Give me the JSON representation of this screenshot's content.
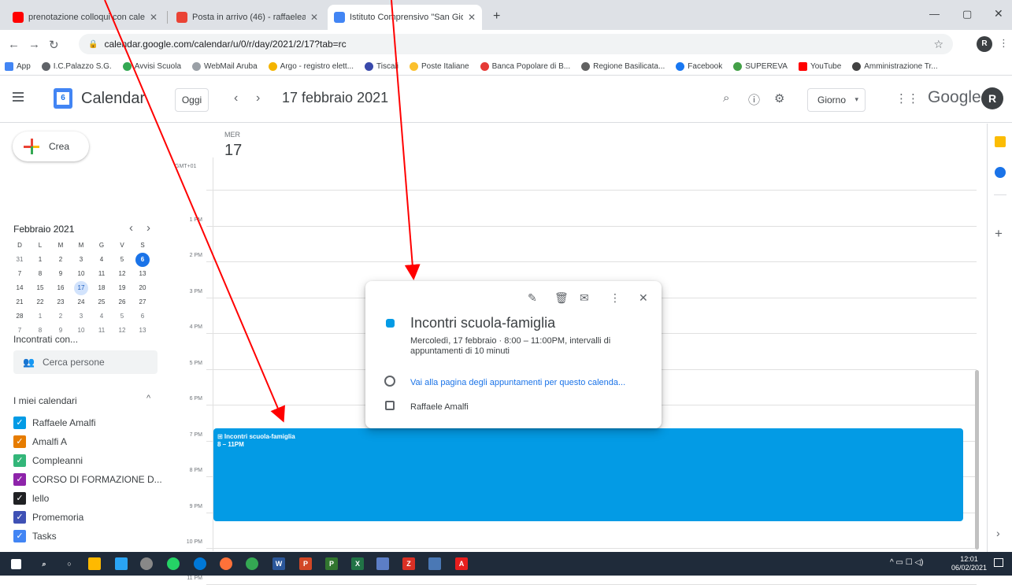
{
  "browser": {
    "tabs": [
      {
        "label": "prenotazione colloqui con calend",
        "color": "#ff0000"
      },
      {
        "label": "Posta in arrivo (46) - raffaeleamal",
        "color": "#ea4335"
      },
      {
        "label": "Istituto Comprensivo \"San Giova",
        "color": "#4285f4"
      }
    ],
    "new_tab": "+",
    "url": "calendar.google.com/calendar/u/0/r/day/2021/2/17?tab=rc",
    "bookmarks": [
      {
        "label": "App",
        "color": "#4285f4"
      },
      {
        "label": "I.C.Palazzo S.G.",
        "color": "#5f6368"
      },
      {
        "label": "Avvisi Scuola",
        "color": "#34a853"
      },
      {
        "label": "WebMail Aruba",
        "color": "#9aa0a6"
      },
      {
        "label": "Argo - registro elett...",
        "color": "#f4b400"
      },
      {
        "label": "Tiscali",
        "color": "#3949ab"
      },
      {
        "label": "Poste Italiane",
        "color": "#fbc02d"
      },
      {
        "label": "Banca Popolare di B...",
        "color": "#e53935"
      },
      {
        "label": "Regione Basilicata...",
        "color": "#616161"
      },
      {
        "label": "Facebook",
        "color": "#1877f2"
      },
      {
        "label": "SUPEREVA",
        "color": "#43a047"
      },
      {
        "label": "YouTube",
        "color": "#ff0000"
      },
      {
        "label": "Amministrazione Tr...",
        "color": "#424242"
      }
    ]
  },
  "header": {
    "app_title": "Calendar",
    "logo_day": "6",
    "today_button": "Oggi",
    "date_title": "17 febbraio 2021",
    "view_selector": "Giorno",
    "google": "Google",
    "avatar": "R"
  },
  "sidebar": {
    "create_label": "Crea",
    "month_title": "Febbraio 2021",
    "weekdays": [
      "D",
      "L",
      "M",
      "M",
      "G",
      "V",
      "S"
    ],
    "weeks": [
      [
        "31",
        "1",
        "2",
        "3",
        "4",
        "5",
        "6"
      ],
      [
        "7",
        "8",
        "9",
        "10",
        "11",
        "12",
        "13"
      ],
      [
        "14",
        "15",
        "16",
        "17",
        "18",
        "19",
        "20"
      ],
      [
        "21",
        "22",
        "23",
        "24",
        "25",
        "26",
        "27"
      ],
      [
        "28",
        "1",
        "2",
        "3",
        "4",
        "5",
        "6"
      ],
      [
        "7",
        "8",
        "9",
        "10",
        "11",
        "12",
        "13"
      ]
    ],
    "meet_heading": "Incontrati con...",
    "search_people": "Cerca persone",
    "my_calendars_heading": "I miei calendari",
    "calendars": [
      {
        "label": "Raffaele Amalfi",
        "color": "#039be5"
      },
      {
        "label": "Amalfi A",
        "color": "#e67c00"
      },
      {
        "label": "Compleanni",
        "color": "#33b679"
      },
      {
        "label": "CORSO DI FORMAZIONE D...",
        "color": "#8e24aa"
      },
      {
        "label": "lello",
        "color": "#202124"
      },
      {
        "label": "Promemoria",
        "color": "#3f51b5"
      },
      {
        "label": "Tasks",
        "color": "#4285f4"
      }
    ]
  },
  "day_view": {
    "weekday": "MER",
    "day_number": "17",
    "timezone": "GMT+01",
    "hour_labels": [
      "1 PM",
      "2 PM",
      "3 PM",
      "4 PM",
      "5 PM",
      "6 PM",
      "7 PM",
      "8 PM",
      "9 PM",
      "10 PM",
      "11 PM"
    ],
    "event": {
      "title": "⊞ Incontri scuola-famiglia",
      "time": "8 – 11PM",
      "color": "#039be5"
    }
  },
  "popup": {
    "title": "Incontri scuola-famiglia",
    "description": "Mercoledì, 17 febbraio  ·  8:00 – 11:00PM, intervalli di appuntamenti di 10 minuti",
    "link": "Vai alla pagina degli appuntamenti per questo calenda...",
    "calendar": "Raffaele Amalfi"
  },
  "taskbar": {
    "time": "12:01",
    "date": "06/02/2021"
  }
}
